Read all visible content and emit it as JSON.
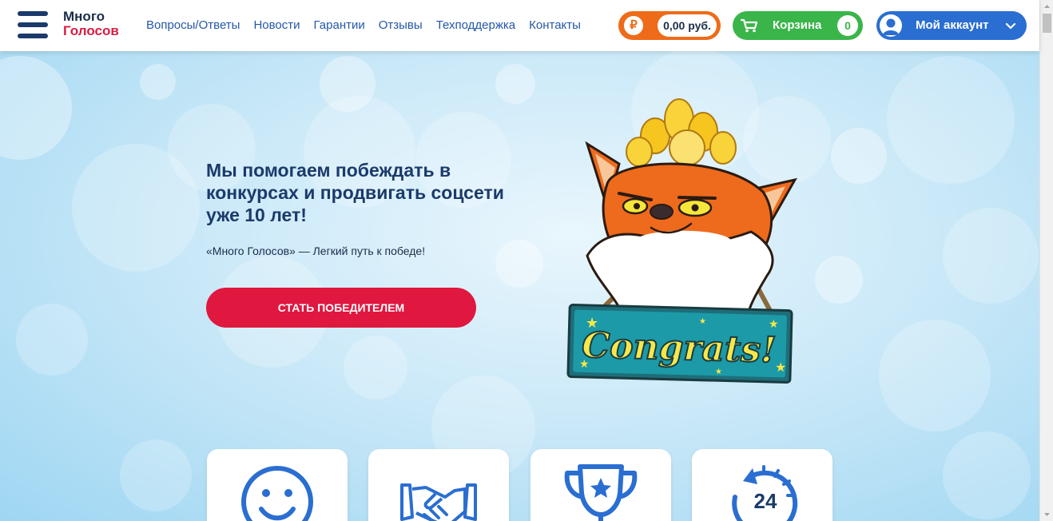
{
  "header": {
    "logo_line1": "Много",
    "logo_line2": "Голосов",
    "nav": [
      "Вопросы/Ответы",
      "Новости",
      "Гарантии",
      "Отзывы",
      "Техподдержка",
      "Контакты"
    ],
    "balance": {
      "currency_symbol": "₽",
      "amount": "0,00 руб."
    },
    "cart": {
      "label": "Корзина",
      "count": "0"
    },
    "account": {
      "label": "Мой аккаунт"
    }
  },
  "hero": {
    "title": "Мы помогаем побеждать в конкурсах и продвигать соцсети уже 10 лет!",
    "subtitle": "«Много Голосов» — Легкий путь к победе!",
    "cta": "Стать победителем",
    "sign_text": "Congrats!"
  },
  "features": [
    {
      "icon": "smiley-icon"
    },
    {
      "icon": "handshake-icon"
    },
    {
      "icon": "trophy-icon"
    },
    {
      "icon": "support-24-icon",
      "text": "24"
    }
  ],
  "colors": {
    "brand_dark": "#1b3a6b",
    "brand_red": "#e0173f",
    "link_blue": "#2458a8",
    "balance_orange": "#ee6b1a",
    "cart_green": "#3ab54a",
    "account_blue": "#2a6ed1",
    "icon_blue": "#2a6ed1"
  }
}
